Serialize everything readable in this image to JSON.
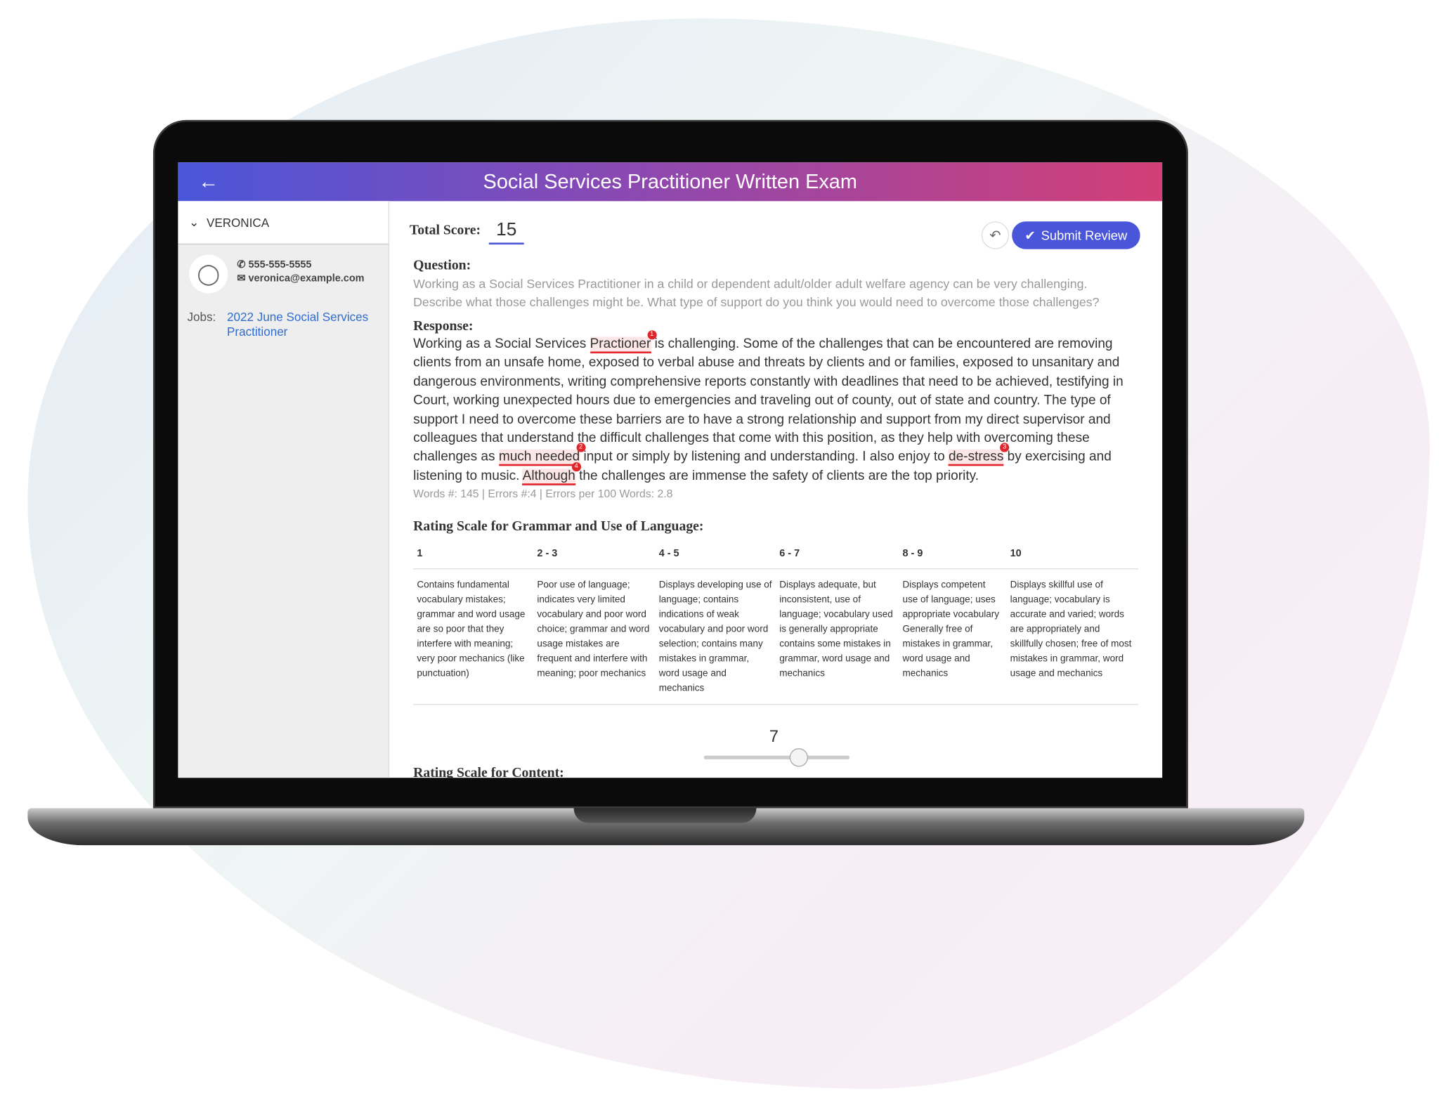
{
  "header": {
    "title": "Social Services Practitioner Written Exam",
    "back_icon": "arrow-left-icon"
  },
  "sidebar": {
    "candidate": "VERONICA",
    "phone": "555-555-5555",
    "email": "veronica@example.com",
    "jobs_label": "Jobs:",
    "job": "2022 June Social Services Practitioner"
  },
  "main": {
    "total_score_label": "Total Score:",
    "total_score": "15",
    "submit_label": "Submit Review",
    "question_label": "Question:",
    "question": "Working as a Social Services Practitioner in a child or dependent adult/older adult welfare agency can be very challenging. Describe what those challenges might be. What type of support do you think you would need to overcome those challenges?",
    "response_label": "Response:",
    "response": {
      "p1": "Working as a Social Services ",
      "e1": "Practioner",
      "p2": " is challenging. Some of the challenges that can be encountered are removing clients from an unsafe home, exposed to verbal abuse and threats by clients and or families, exposed to unsanitary and dangerous environments, writing comprehensive reports constantly with deadlines that need to be achieved, testifying in Court, working unexpected hours due to emergencies and traveling out of county, out of state and country. The type of support I need to overcome these barriers are to have a strong relationship and support from my direct supervisor and colleagues that understand the difficult challenges that come with this position, as they help with overcoming these challenges as ",
      "e2": "much needed",
      "p3": " input or simply by listening and understanding. I also enjoy to ",
      "e3": "de-stress",
      "p4": " by exercising and listening to music. ",
      "e4": "Although",
      "p5": " the challenges are immense the safety of clients are the top priority.",
      "n1": "1",
      "n2": "2",
      "n3": "3",
      "n4": "4"
    },
    "stats": "Words #: 145 | Errors #:4 | Errors per 100 Words: 2.8",
    "grammar_scale_label": "Rating Scale for Grammar and Use of Language:",
    "scale_headers": [
      "1",
      "2 - 3",
      "4 - 5",
      "6 - 7",
      "8 - 9",
      "10"
    ],
    "scale_desc": [
      "Contains fundamental vocabulary mistakes; grammar and word usage are so poor that they interfere with meaning; very poor mechanics (like punctuation)",
      "Poor use of language; indicates very limited vocabulary and poor word choice; grammar and word usage mistakes are frequent and interfere with meaning; poor mechanics",
      "Displays developing use of language; contains indications of weak vocabulary and poor word selection; contains many mistakes in grammar, word usage and mechanics",
      "Displays adequate, but inconsistent, use of language; vocabulary used is generally appropriate contains some mistakes in grammar, word usage and mechanics",
      "Displays competent use of language; uses appropriate vocabulary Generally free of mistakes in grammar, word usage and mechanics",
      "Displays skillful use of language; vocabulary is accurate and varied; words are appropriately and skillfully chosen; free of most mistakes in grammar, word usage and mechanics"
    ],
    "grammar_rating": "7",
    "content_scale_label": "Rating Scale for Content:"
  }
}
